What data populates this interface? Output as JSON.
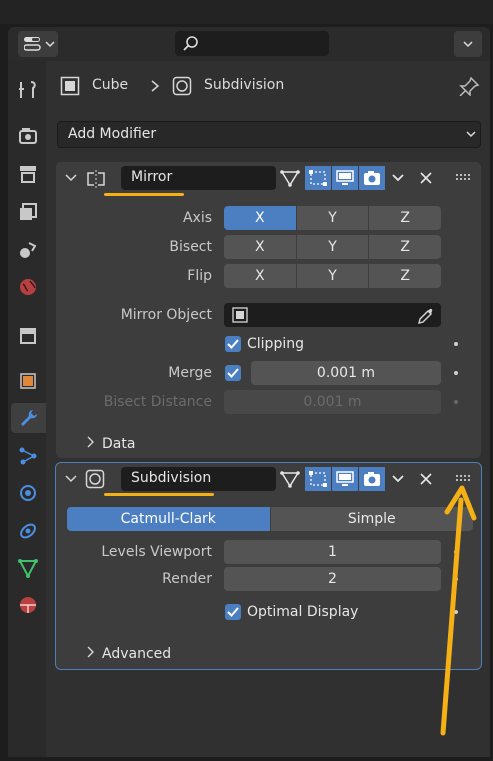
{
  "breadcrumb": {
    "object": "Cube",
    "modifier": "Subdivision"
  },
  "add_modifier": "Add Modifier",
  "mirror": {
    "name": "Mirror",
    "axis_label": "Axis",
    "bisect_label": "Bisect",
    "flip_label": "Flip",
    "axes": [
      "X",
      "Y",
      "Z"
    ],
    "axis_selected": "X",
    "mirror_object_label": "Mirror Object",
    "clipping_label": "Clipping",
    "clipping": true,
    "merge_label": "Merge",
    "merge_checked": true,
    "merge_value": "0.001 m",
    "bisect_distance_label": "Bisect Distance",
    "bisect_distance_value": "0.001 m",
    "data_panel": "Data"
  },
  "subdivision": {
    "name": "Subdivision",
    "method_options": [
      "Catmull-Clark",
      "Simple"
    ],
    "method_selected": "Catmull-Clark",
    "levels_viewport_label": "Levels Viewport",
    "levels_viewport": "1",
    "render_label": "Render",
    "render": "2",
    "optimal_display_label": "Optimal Display",
    "optimal_display": true,
    "advanced_panel": "Advanced"
  },
  "colors": {
    "accent": "#4c7ec2",
    "annotation": "#f5b015"
  },
  "sidebar_tabs": [
    "tool-icon",
    "render-icon",
    "output-icon",
    "view-layer-icon",
    "scene-icon",
    "world-icon",
    "collection-icon",
    "object-icon",
    "modifier-icon",
    "particles-icon",
    "physics-icon",
    "constraints-icon",
    "data-icon",
    "material-icon"
  ]
}
